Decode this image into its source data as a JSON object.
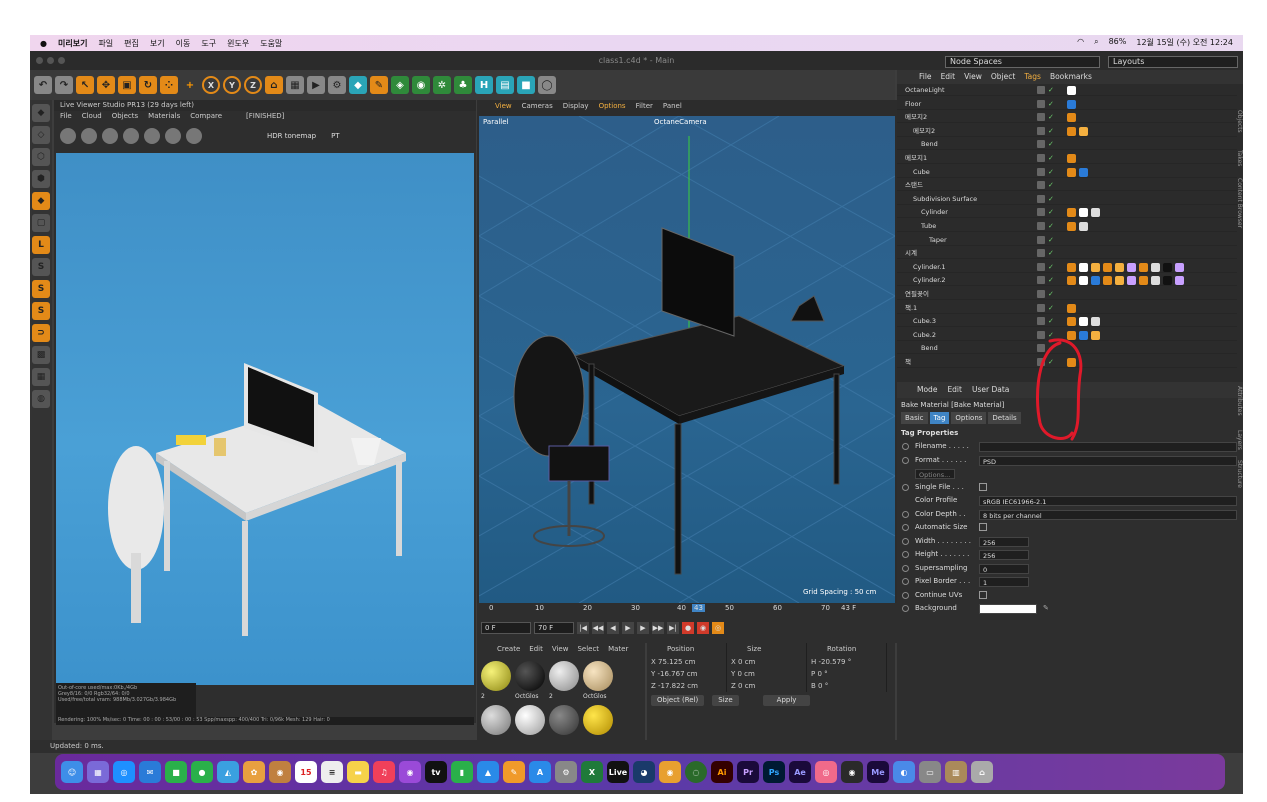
{
  "menubar": {
    "apple": "",
    "items": [
      "미리보기",
      "파일",
      "편집",
      "보기",
      "이동",
      "도구",
      "윈도우",
      "도움말"
    ],
    "battery": "86%",
    "clock": "12월 15일 (수) 오전 12:24"
  },
  "window": {
    "title": "class1.c4d * - Main",
    "node_spaces": "Node Spaces",
    "layouts": "Layouts"
  },
  "live_viewer": {
    "title": "Live Viewer Studio PR13 (29 days left)",
    "menu": [
      "File",
      "Cloud",
      "Objects",
      "Materials",
      "Compare"
    ],
    "state": "[FINISHED]",
    "tonemap": "HDR tonemap",
    "mode": "PT",
    "stats": [
      "Out-of-core used/max:0Kb,/4Gb",
      "Grey8/16: 0/0       Rgb32/64: 0/0",
      "Used/free/total vram: 988Mb/3.027Gb/3.984Gb"
    ],
    "statusline": "Rendering: 100%   Ms/sec: 0    Time: 00 : 00 : 53/00 : 00 : 53    Spp/maxspp: 400/400    Tri: 0/96k    Mesh: 129    Hair: 0"
  },
  "viewport": {
    "menu": [
      "View",
      "Cameras",
      "Display",
      "Options",
      "Filter",
      "Panel"
    ],
    "projection": "Parallel",
    "camera": "OctaneCamera",
    "grid_spacing": "Grid Spacing : 50 cm"
  },
  "timeline": {
    "ticks": [
      "0",
      "10",
      "20",
      "30",
      "40",
      "43",
      "50",
      "60",
      "70"
    ],
    "current_frame": "43 F",
    "start": "0 F",
    "end": "70 F"
  },
  "material_manager": {
    "menu": [
      "Create",
      "Edit",
      "View",
      "Select",
      "Mater"
    ],
    "labels": [
      "2",
      "OctGlos",
      "2",
      "OctGlos"
    ]
  },
  "coordinates": {
    "headers": [
      "Position",
      "Size",
      "Rotation"
    ],
    "rows": [
      {
        "a": "X  75.125 cm",
        "b": "X  0 cm",
        "c": "H  -20.579 °"
      },
      {
        "a": "Y  -16.767 cm",
        "b": "Y  0 cm",
        "c": "P  0 °"
      },
      {
        "a": "Z  -17.822 cm",
        "b": "Z  0 cm",
        "c": "B  0 °"
      }
    ],
    "mode": "Object (Rel)",
    "size_mode": "Size",
    "apply": "Apply"
  },
  "status": "Updated: 0 ms.",
  "object_manager": {
    "menu": [
      "File",
      "Edit",
      "View",
      "Object",
      "Tags",
      "Bookmarks"
    ],
    "rows": [
      {
        "name": "OctaneLight"
      },
      {
        "name": "Floor"
      },
      {
        "name": "메모지2"
      },
      {
        "name": "메모지2"
      },
      {
        "name": "Bend"
      },
      {
        "name": "메모지1"
      },
      {
        "name": "Cube"
      },
      {
        "name": "스탠드"
      },
      {
        "name": "Subdivision Surface"
      },
      {
        "name": "Cylinder"
      },
      {
        "name": "Tube"
      },
      {
        "name": "Taper"
      },
      {
        "name": "시계"
      },
      {
        "name": "Cylinder.1"
      },
      {
        "name": "Cylinder.2"
      },
      {
        "name": "연필꽂이"
      },
      {
        "name": "책.1"
      },
      {
        "name": "Cube.3"
      },
      {
        "name": "Cube.2"
      },
      {
        "name": "Bend"
      },
      {
        "name": "책"
      }
    ],
    "side_tabs": [
      "Objects",
      "Takes",
      "Content Browser"
    ]
  },
  "attributes": {
    "menu": [
      "Mode",
      "Edit",
      "User Data"
    ],
    "object": "Bake Material [Bake Material]",
    "tabs": [
      "Basic",
      "Tag",
      "Options",
      "Details"
    ],
    "section": "Tag Properties",
    "filename": "Filename . . . . .",
    "format_label": "Format . . . . . .",
    "format_value": "PSD",
    "options_btn": "Options...",
    "single_file": "Single File . . .",
    "color_profile_label": "Color Profile",
    "color_profile_value": "sRGB IEC61966-2.1",
    "color_depth_label": "Color Depth . .",
    "color_depth_value": "8 bits per channel",
    "auto_size": "Automatic Size",
    "width_label": "Width . . . . . . . .",
    "width_value": "256",
    "height_label": "Height . . . . . . .",
    "height_value": "256",
    "supersampling_label": "Supersampling",
    "supersampling_value": "0",
    "pixel_border_label": "Pixel Border . . .",
    "pixel_border_value": "1",
    "continue_uvs": "Continue UVs",
    "background_label": "Background",
    "side_tabs": [
      "Attributes",
      "Layers",
      "Structure"
    ]
  },
  "dock": {
    "items": [
      "15",
      "tv",
      "Ai",
      "Pr",
      "Ps",
      "Ae",
      "Me",
      "Live"
    ]
  },
  "colors": {
    "accent": "#f4b040",
    "selection": "#3f84c4",
    "annotation": "#e0192a"
  }
}
